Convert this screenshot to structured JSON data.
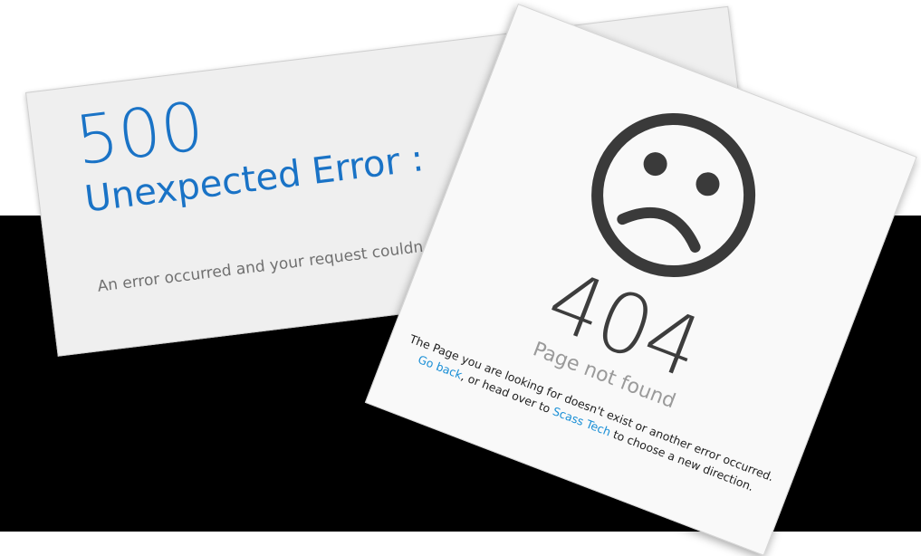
{
  "error500": {
    "code": "500",
    "title": "Unexpected Error :",
    "message": "An error occurred and your request couldn"
  },
  "error404": {
    "icon": "sad-face-icon",
    "code": "404",
    "subtitle": "Page not found",
    "message_line1": "The Page you are looking for doesn't exist or another error occurred.",
    "go_back_link": "Go back",
    "message_line2_mid": ", or head over to ",
    "site_link": "Scass Tech",
    "message_line2_end": " to choose a new direction."
  },
  "colors": {
    "blue_text": "#1a73c6",
    "link": "#1a8fd6",
    "background_band": "#000000"
  }
}
